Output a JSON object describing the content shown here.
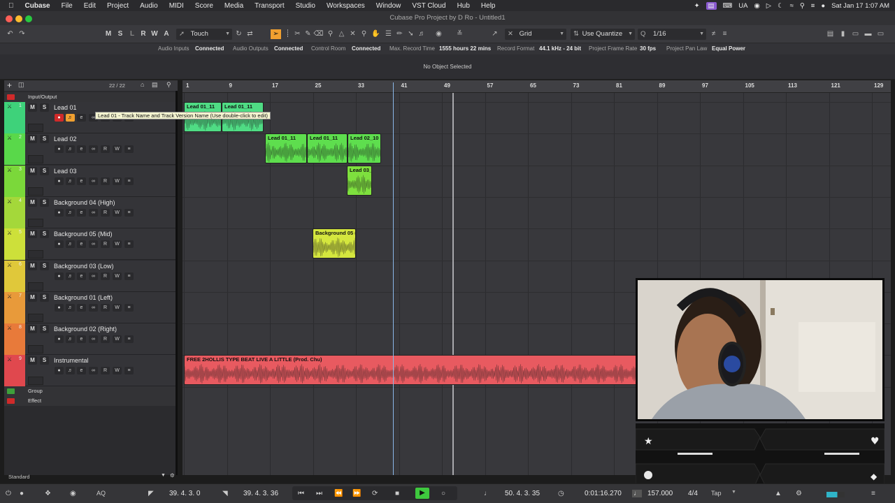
{
  "menubar": {
    "app": "Cubase",
    "items": [
      "File",
      "Edit",
      "Project",
      "Audio",
      "MIDI",
      "Score",
      "Media",
      "Transport",
      "Studio",
      "Workspaces",
      "Window",
      "VST Cloud",
      "Hub",
      "Help"
    ],
    "status_right": [
      "UA"
    ],
    "datetime": "Sat Jan 17  1:07 AM"
  },
  "window": {
    "title": "Cubase Pro Project by D Ro - Untitled1"
  },
  "toolbar": {
    "track_buttons": [
      "M",
      "S",
      "L",
      "R",
      "W",
      "A"
    ],
    "automation_mode": "Touch",
    "snap_type": "Grid",
    "quantize_type": "Use Quantize",
    "quantize_value": "1/16"
  },
  "statusline": {
    "audio_inputs_label": "Audio Inputs",
    "audio_inputs_value": "Connected",
    "audio_outputs_label": "Audio Outputs",
    "audio_outputs_value": "Connected",
    "control_room_label": "Control Room",
    "control_room_value": "Connected",
    "max_record_label": "Max. Record Time",
    "max_record_value": "1555 hours 22 mins",
    "record_format_label": "Record Format",
    "record_format_value": "44.1 kHz - 24 bit",
    "frame_rate_label": "Project Frame Rate",
    "frame_rate_value": "30 fps",
    "pan_law_label": "Project Pan Law",
    "pan_law_value": "Equal Power"
  },
  "infoline": {
    "text": "No Object Selected"
  },
  "tracklist": {
    "count": "22 / 22",
    "io_folder": "Input/Output",
    "group_folder": "Group",
    "effect_folder": "Effect",
    "tracks": [
      {
        "num": "1",
        "name": "Lead 01",
        "color": "#3ed27a"
      },
      {
        "num": "2",
        "name": "Lead 02",
        "color": "#59d84a"
      },
      {
        "num": "3",
        "name": "Lead 03",
        "color": "#7bd83a"
      },
      {
        "num": "4",
        "name": "Background 04 (High)",
        "color": "#a4d83a"
      },
      {
        "num": "5",
        "name": "Background 05 (Mid)",
        "color": "#cde03a"
      },
      {
        "num": "6",
        "name": "Background 03 (Low)",
        "color": "#e0c83a"
      },
      {
        "num": "7",
        "name": "Background 01 (Left)",
        "color": "#e89a3a"
      },
      {
        "num": "8",
        "name": "Background 02 (Right)",
        "color": "#e87a3a"
      },
      {
        "num": "9",
        "name": "Instrumental",
        "color": "#e0484e"
      }
    ],
    "buttons": {
      "m": "M",
      "s": "S",
      "r": "R",
      "w": "W"
    }
  },
  "tooltip": "Lead 01 - Track Name and Track Version Name (Use double-click to edit)",
  "ruler": [
    "1",
    "9",
    "17",
    "25",
    "33",
    "41",
    "49",
    "57",
    "65",
    "73",
    "81",
    "89",
    "97",
    "105",
    "113",
    "121",
    "129"
  ],
  "events": [
    {
      "name": "Lead 01_11",
      "track": 0,
      "color": "#4fdc84"
    },
    {
      "name": "Lead 01_11",
      "track": 0,
      "color": "#4fdc84"
    },
    {
      "name": "Lead 01_11",
      "track": 1,
      "color": "#5ede4e"
    },
    {
      "name": "Lead 01_11",
      "track": 1,
      "color": "#5ede4e"
    },
    {
      "name": "Lead 02_10",
      "track": 1,
      "color": "#5ede4e"
    },
    {
      "name": "Lead 03_",
      "track": 2,
      "color": "#7ee03e"
    },
    {
      "name": "Background 05 (",
      "track": 4,
      "color": "#d4e63e"
    },
    {
      "name": "FREE 2HOLLIS TYPE BEAT  LIVE A LITTLE (Prod. Chu)",
      "track": 8,
      "color": "#e85a60"
    }
  ],
  "bottom": {
    "preset": "Standard"
  },
  "transport": {
    "left_locator": "39. 4. 3.   0",
    "right_locator": "39. 4. 3. 36",
    "position": "50. 4. 3. 35",
    "time": "0:01:16.270",
    "tempo": "157.000",
    "signature": "4/4",
    "tap": "Tap"
  },
  "colors": {
    "accent": "#f0a030",
    "cursor": "#8ab8e8",
    "play": "#3ec83e"
  }
}
